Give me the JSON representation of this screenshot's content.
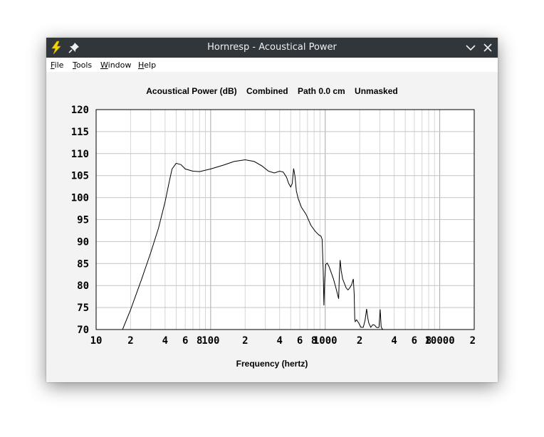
{
  "window": {
    "title": "Hornresp - Acoustical Power",
    "icons": [
      "lightning-app-icon",
      "pin-icon",
      "chevron-down-icon",
      "close-icon"
    ]
  },
  "menu": {
    "file": {
      "mnemonic": "F",
      "rest": "ile"
    },
    "tools": {
      "mnemonic": "T",
      "rest": "ools"
    },
    "window": {
      "mnemonic": "W",
      "rest": "indow"
    },
    "help": {
      "mnemonic": "H",
      "rest": "elp"
    }
  },
  "chart_data": {
    "type": "line",
    "title_parts": [
      "Acoustical Power (dB)",
      "Combined",
      "Path 0.0 cm",
      "Unmasked"
    ],
    "xlabel": "Frequency (hertz)",
    "ylabel": "",
    "xscale": "log",
    "xlim": [
      10,
      20000
    ],
    "ylim": [
      70,
      120
    ],
    "yticks": [
      "120",
      "115",
      "110",
      "105",
      "100",
      "95",
      "90",
      "85",
      "80",
      "75",
      "70"
    ],
    "xticks": [
      {
        "f": 10,
        "label": "10"
      },
      {
        "f": 20,
        "label": "2"
      },
      {
        "f": 40,
        "label": "4"
      },
      {
        "f": 60,
        "label": "6"
      },
      {
        "f": 80,
        "label": "8"
      },
      {
        "f": 100,
        "label": "100"
      },
      {
        "f": 200,
        "label": "2"
      },
      {
        "f": 400,
        "label": "4"
      },
      {
        "f": 600,
        "label": "6"
      },
      {
        "f": 800,
        "label": "8"
      },
      {
        "f": 1000,
        "label": "1000"
      },
      {
        "f": 2000,
        "label": "2"
      },
      {
        "f": 4000,
        "label": "4"
      },
      {
        "f": 6000,
        "label": "6"
      },
      {
        "f": 8000,
        "label": "8"
      },
      {
        "f": 10000,
        "label": "10000"
      },
      {
        "f": 20000,
        "label": "2"
      }
    ],
    "grid": true,
    "series": [
      {
        "x": [
          17,
          20,
          25,
          30,
          35,
          40,
          43,
          46,
          50,
          55,
          60,
          70,
          80,
          100,
          130,
          160,
          200,
          240,
          280,
          320,
          360,
          400,
          430,
          460,
          480,
          500,
          515,
          530,
          545,
          560,
          580,
          620,
          680,
          750,
          820,
          880,
          920,
          940,
          960,
          975,
          990,
          1010,
          1040,
          1080,
          1120,
          1180,
          1240,
          1310,
          1330,
          1350,
          1380,
          1420,
          1470,
          1520,
          1580,
          1640,
          1700,
          1760,
          1790,
          1810,
          1830,
          1880,
          1960,
          2050,
          2150,
          2230,
          2300,
          2330,
          2360,
          2400,
          2500,
          2600,
          2700,
          2800,
          2900,
          2950,
          3020,
          3080,
          3130,
          3200
        ],
        "y": [
          70,
          74.5,
          81.5,
          87.5,
          93,
          99,
          103,
          106.5,
          107.8,
          107.5,
          106.5,
          106,
          105.9,
          106.5,
          107.4,
          108.2,
          108.6,
          108.2,
          107.2,
          106,
          105.6,
          106,
          105.8,
          104.6,
          103.2,
          102.4,
          103.2,
          106.6,
          104.8,
          101.5,
          99.8,
          97.8,
          96.2,
          93.7,
          92.3,
          91.5,
          91.2,
          90.5,
          83.5,
          75.5,
          81.2,
          84.8,
          85.1,
          84.3,
          83.2,
          81.5,
          79.5,
          77,
          82.5,
          85.8,
          83.4,
          81.5,
          80.5,
          79.5,
          79,
          79.5,
          80.2,
          81.5,
          78.2,
          72.5,
          71.8,
          72.2,
          71.5,
          70.5,
          70.5,
          72.1,
          74.7,
          73.5,
          72.5,
          71.5,
          70.5,
          71.1,
          71,
          70.5,
          70.4,
          70.6,
          74.6,
          70.7,
          70.2,
          70
        ]
      }
    ]
  }
}
